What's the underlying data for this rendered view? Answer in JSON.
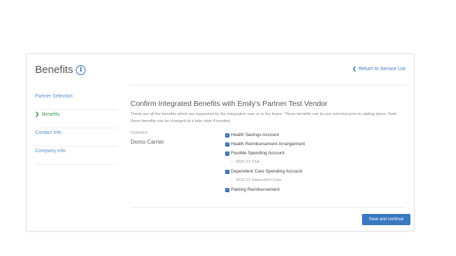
{
  "header": {
    "title": "Benefits",
    "info_icon": "info-icon",
    "return_link": "Return to Service List"
  },
  "sidebar": {
    "items": [
      {
        "label": "Partner Selection",
        "active": false
      },
      {
        "label": "Benefits",
        "active": true
      },
      {
        "label": "Contact Info",
        "active": false
      },
      {
        "label": "Company Info",
        "active": false
      }
    ]
  },
  "main": {
    "title": "Confirm Integrated Benefits with Emily's Partner Test Vendor",
    "description": "These are all the benefits which are supported by the integration now or in the future. These benefits can be pre selected prior to adding plans. Note: these benefits can be changed at a later date if needed.",
    "carrier_label": "CARRIER",
    "carrier_name": "Demo Carrier",
    "benefits": [
      {
        "label": "Health Savings Account",
        "checked": true
      },
      {
        "label": "Health Reimbursement Arrangement",
        "checked": true
      },
      {
        "label": "Flexible Spending Account",
        "checked": true,
        "sub": "2020-21 FSA"
      },
      {
        "label": "Dependent Care Spending Account",
        "checked": true,
        "sub": "2020-21 Dependent Care"
      },
      {
        "label": "Parking Reimbursement",
        "checked": true
      }
    ],
    "save_button": "Save and continue"
  },
  "colors": {
    "accent": "#3a78c0",
    "active_nav": "#3a9a48",
    "link": "#3a7cc4"
  }
}
